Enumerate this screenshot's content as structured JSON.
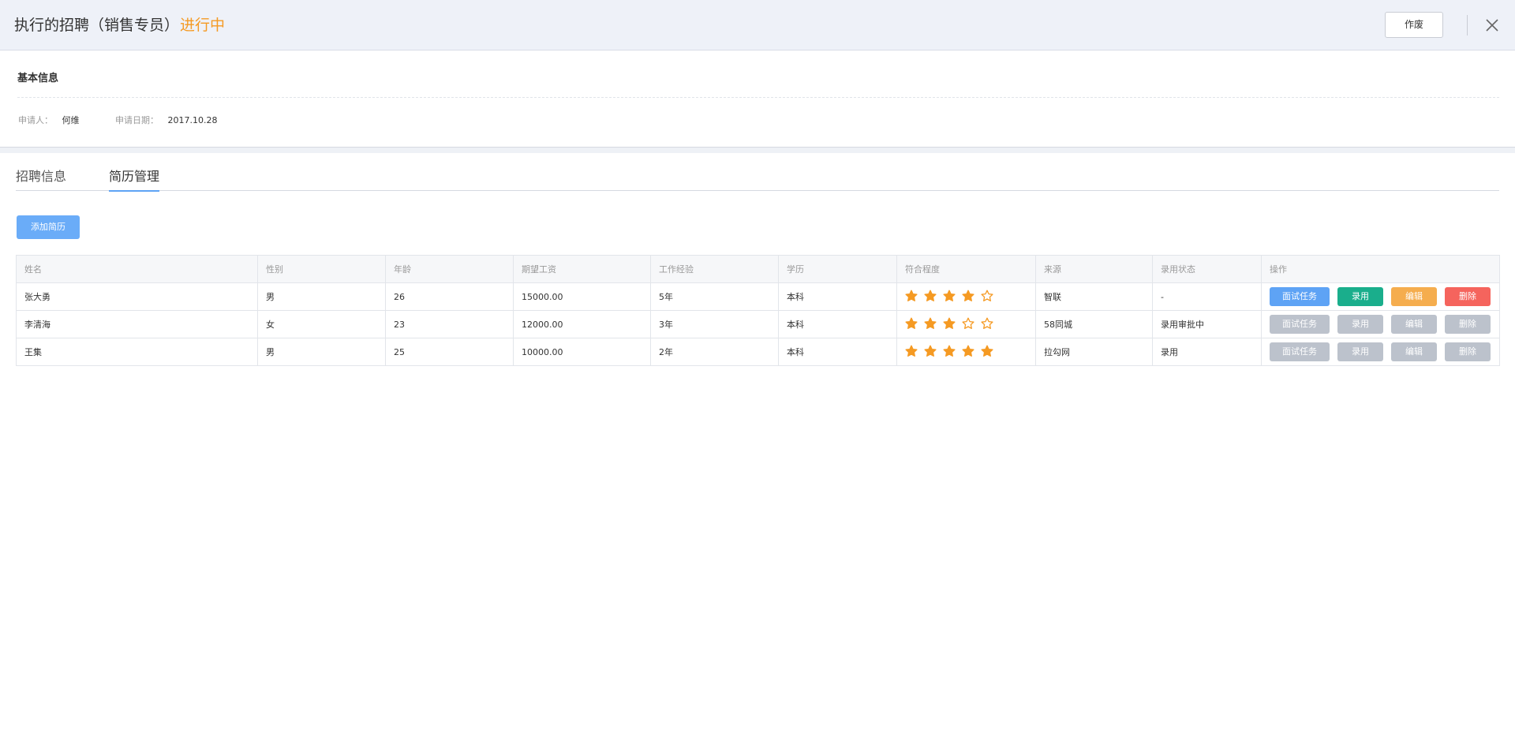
{
  "header": {
    "title": "执行的招聘（销售专员）",
    "status": "进行中",
    "void_label": "作废"
  },
  "basic_info": {
    "section_title": "基本信息",
    "applicant_label": "申请人：",
    "applicant_value": "何维",
    "date_label": "申请日期：",
    "date_value": "2017.10.28"
  },
  "tabs": [
    {
      "label": "招聘信息",
      "active": false
    },
    {
      "label": "简历管理",
      "active": true
    }
  ],
  "add_resume_label": "添加简历",
  "table": {
    "columns": [
      "姓名",
      "性别",
      "年龄",
      "期望工资",
      "工作经验",
      "学历",
      "符合程度",
      "来源",
      "录用状态",
      "操作"
    ],
    "rows": [
      {
        "name": "张大勇",
        "gender": "男",
        "age": "26",
        "salary": "15000.00",
        "experience": "5年",
        "education": "本科",
        "rating": 4,
        "source": "智联",
        "status": "-",
        "actions_enabled": true
      },
      {
        "name": "李清海",
        "gender": "女",
        "age": "23",
        "salary": "12000.00",
        "experience": "3年",
        "education": "本科",
        "rating": 3,
        "source": "58同城",
        "status": "录用审批中",
        "actions_enabled": false
      },
      {
        "name": "王集",
        "gender": "男",
        "age": "25",
        "salary": "10000.00",
        "experience": "2年",
        "education": "本科",
        "rating": 5,
        "source": "拉勾网",
        "status": "录用",
        "actions_enabled": false
      }
    ],
    "max_rating": 5,
    "actions": {
      "interview": "面试任务",
      "hire": "录用",
      "edit": "编辑",
      "delete": "删除"
    }
  },
  "colors": {
    "status_orange": "#f59a23",
    "star": "#f59a23",
    "interview_btn": "#5ea3f5",
    "hire_btn": "#1aae8c",
    "edit_btn": "#f5ad4e",
    "delete_btn": "#f5645d",
    "disabled_btn": "#bcc2cc",
    "add_btn": "#6aacf8"
  }
}
